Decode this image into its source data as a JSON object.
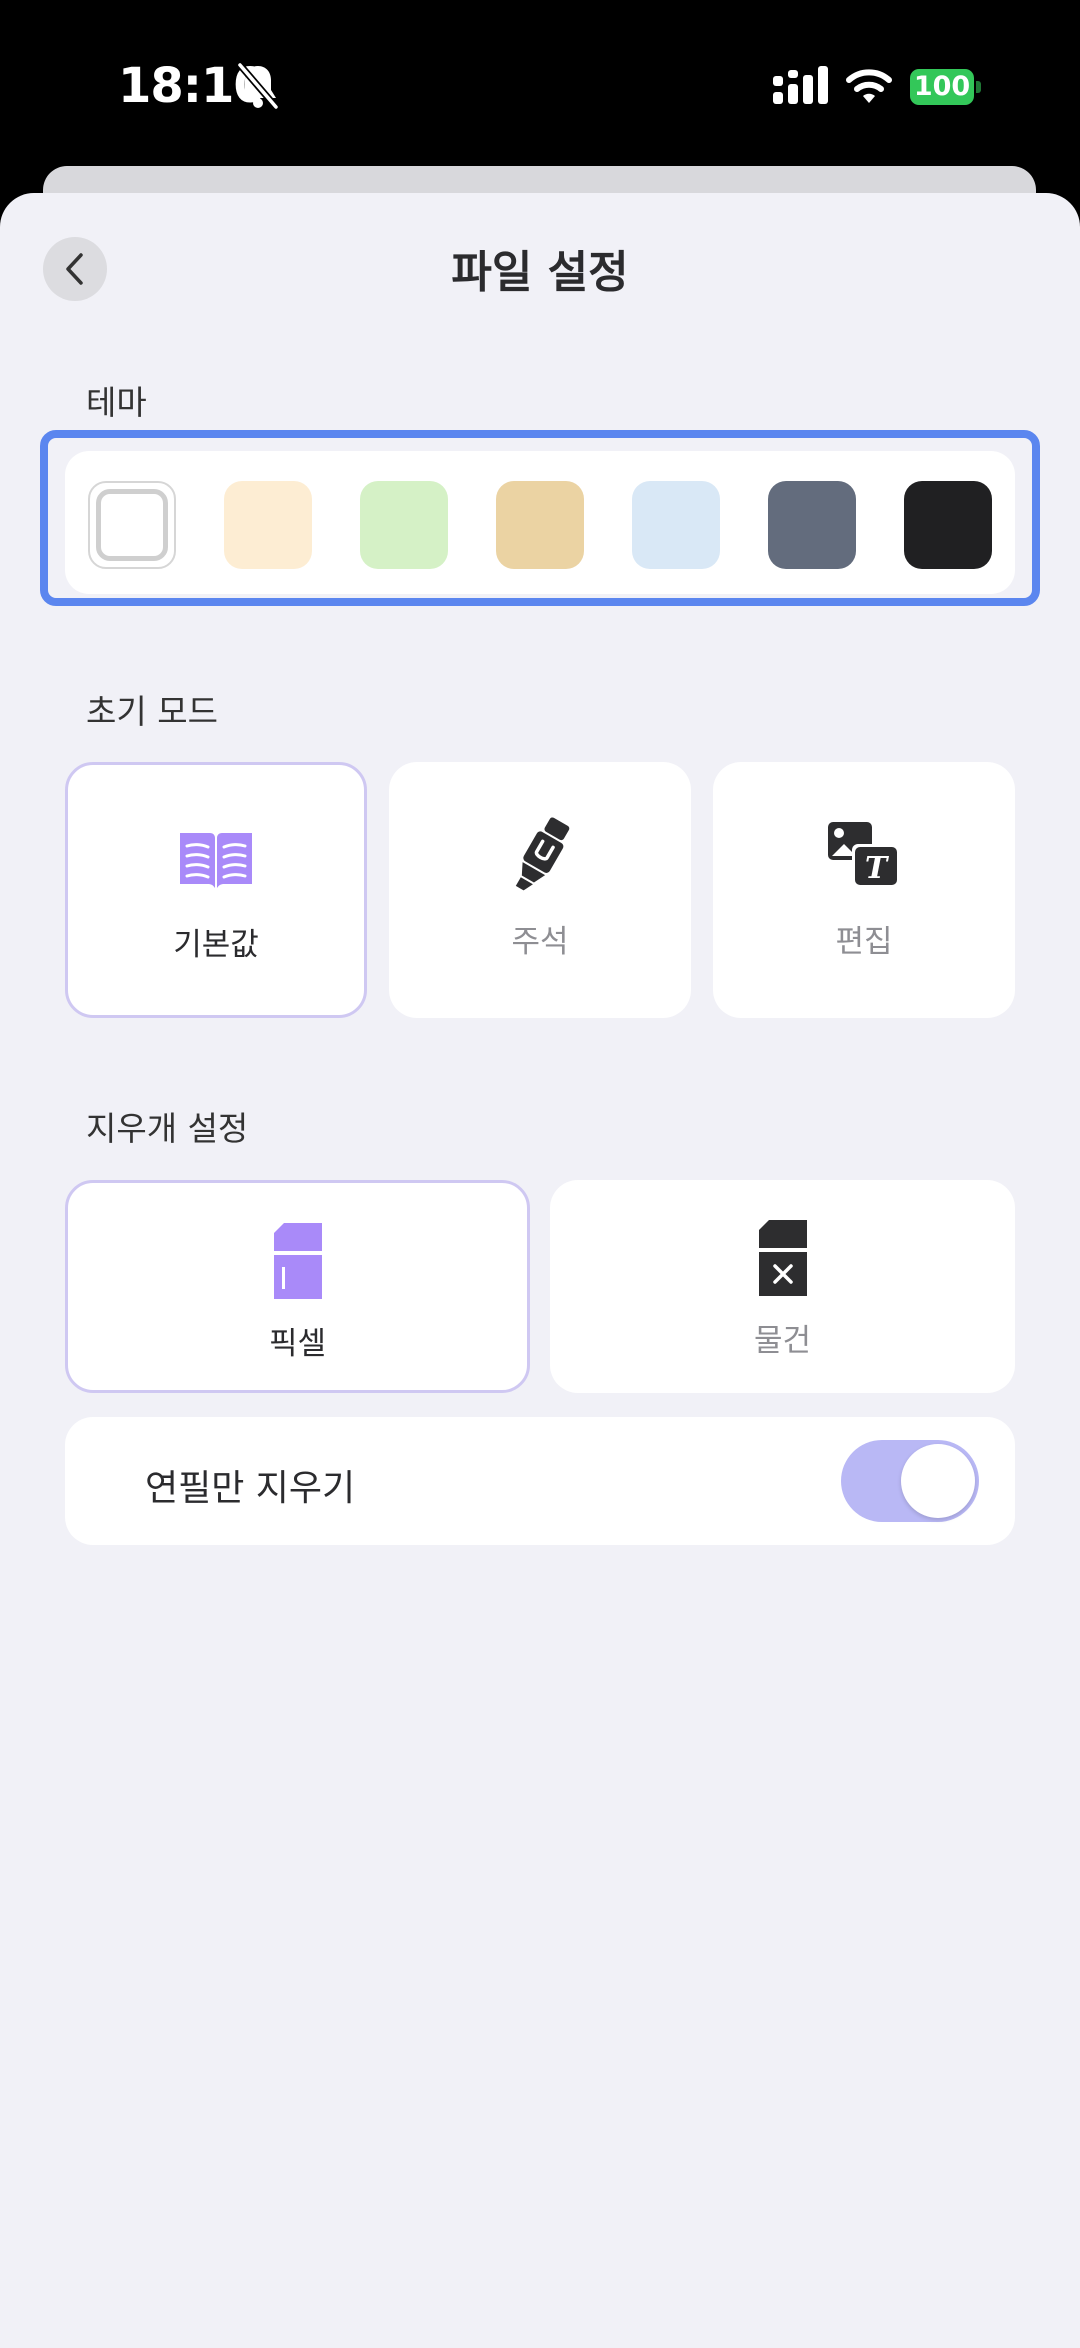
{
  "status_bar": {
    "time": "18:10",
    "battery": "100",
    "icons": [
      "bell-slash-icon",
      "cellular-signal-icon",
      "wifi-icon",
      "battery-icon"
    ]
  },
  "header": {
    "title": "파일 설정",
    "back_icon": "chevron-left-icon"
  },
  "theme": {
    "label": "테마",
    "swatches": [
      {
        "name": "white",
        "color": "#ffffff",
        "selected": true
      },
      {
        "name": "cream",
        "color": "#fdedd3",
        "selected": false
      },
      {
        "name": "light-green",
        "color": "#d5f1c6",
        "selected": false
      },
      {
        "name": "tan",
        "color": "#ebd3a3",
        "selected": false
      },
      {
        "name": "light-blue",
        "color": "#d9e8f6",
        "selected": false
      },
      {
        "name": "slate",
        "color": "#636c7d",
        "selected": false
      },
      {
        "name": "black",
        "color": "#202022",
        "selected": false
      }
    ]
  },
  "initial_mode": {
    "label": "초기 모드",
    "options": [
      {
        "label": "기본값",
        "icon": "open-book-icon",
        "selected": true
      },
      {
        "label": "주석",
        "icon": "highlighter-icon",
        "selected": false
      },
      {
        "label": "편집",
        "icon": "image-text-icon",
        "selected": false
      }
    ]
  },
  "eraser": {
    "label": "지우개 설정",
    "options": [
      {
        "label": "픽셀",
        "icon": "pixel-eraser-icon",
        "selected": true
      },
      {
        "label": "물건",
        "icon": "object-eraser-icon",
        "selected": false
      }
    ],
    "pen_only": {
      "label": "연필만 지우기",
      "enabled": true
    }
  },
  "colors": {
    "accent": "#5b86ef",
    "purple": "#a98af9",
    "selected_border": "#cfc8f2",
    "toggle_on": "#b9b8f5",
    "background": "#f1f1f7"
  }
}
